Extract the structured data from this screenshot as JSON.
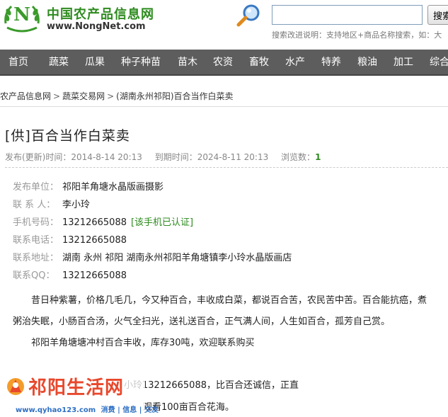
{
  "site": {
    "name_cn": "中国农产品信息网",
    "url": "www.NongNet.com"
  },
  "search": {
    "value": "",
    "button_label": "搜索",
    "hint": "搜索改进说明：支持地区+商品名称搜索，如：大"
  },
  "nav": {
    "items": [
      "首页",
      "蔬菜",
      "瓜果",
      "种子种苗",
      "苗木",
      "农资",
      "畜牧",
      "水产",
      "特养",
      "粮油",
      "加工",
      "综合"
    ]
  },
  "breadcrumb": {
    "items": [
      "农产品信息网",
      "蔬菜交易网",
      "(湖南永州祁阳)百合当作白菜卖"
    ],
    "separator": ">"
  },
  "listing": {
    "title": "[供]百合当作白菜卖",
    "published_label": "发布(更新)时间：",
    "published": "2014-8-14 20:13",
    "expires_label": "到期时间：",
    "expires": "2024-8-11 20:13",
    "views_label": "浏览数：",
    "views": "1"
  },
  "contact": {
    "company_label": "发布单位：",
    "company": "祁阳羊角塘水晶版画摄影",
    "person_label": "联 系 人：",
    "person": "李小玲",
    "mobile_label": "手机号码：",
    "mobile": "13212665088",
    "mobile_verified": "[该手机已认证]",
    "phone_label": "联系电话：",
    "phone": "13212665088",
    "address_label": "联系地址：",
    "address": "湖南  永州  祁阳  湖南永州祁阳羊角塘镇李小玲水晶版画店",
    "qq_label": "联系QQ：",
    "qq": "13212665088"
  },
  "description": {
    "para1": "昔日种紫薯，价格几毛几，今又种百合，丰收成白菜，都说百合苦，农民苦中苦。百合能抗癌，煮粥治失眠，小肠百合汤，火气全扫光，送礼送百合，正气满人间，人生如百合，孤芳自己赏。",
    "para2": "祁阳羊角塘塘冲村百合丰收，库存30吨，欢迎联系购买",
    "para3": "小玲13212665088，比百合还诚信，正直",
    "para4": "观看100亩百合花海。"
  },
  "watermark": {
    "title": "祁阳生活网",
    "url": "www.qyhao123.com",
    "tags": "消费 | 信息 | 交友"
  }
}
